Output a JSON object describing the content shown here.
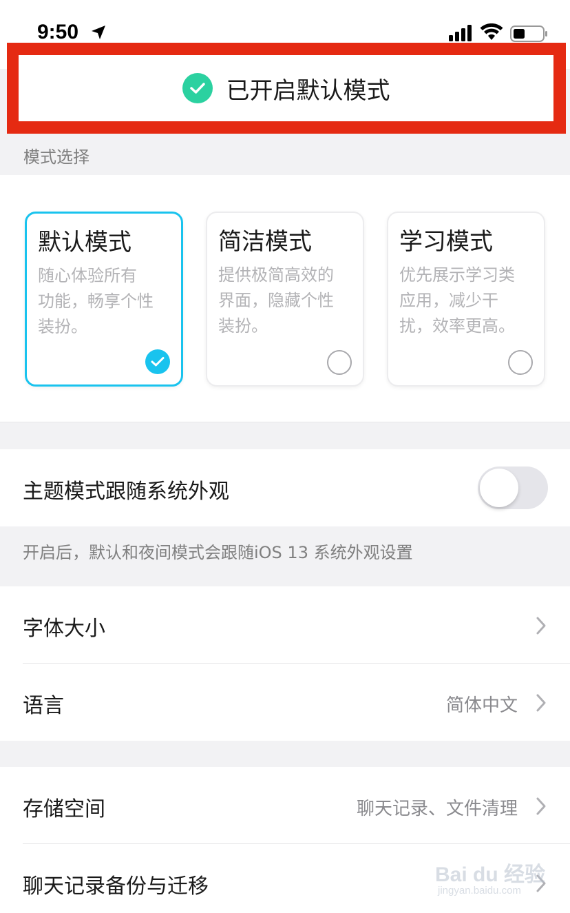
{
  "status_bar": {
    "time": "9:50"
  },
  "toast": {
    "text": "已开启默认模式"
  },
  "mode_section": {
    "header": "模式选择",
    "cards": [
      {
        "title": "默认模式",
        "desc_lines": [
          "随心体验所有",
          "功能，畅享个性",
          "装扮。"
        ],
        "selected": true
      },
      {
        "title": "简洁模式",
        "desc_lines": [
          "提供极简高效的",
          "界面，隐藏个性",
          "装扮。"
        ],
        "selected": false
      },
      {
        "title": "学习模式",
        "desc_lines": [
          "优先展示学习类",
          "应用，减少干",
          "扰，效率更高。"
        ],
        "selected": false
      }
    ]
  },
  "theme": {
    "label": "主题模式跟随系统外观",
    "toggle_on": false,
    "note": "开启后，默认和夜间模式会跟随iOS 13 系统外观设置"
  },
  "group1": {
    "font_size_label": "字体大小",
    "language_label": "语言",
    "language_value": "简体中文"
  },
  "group2": {
    "storage_label": "存储空间",
    "storage_value": "聊天记录、文件清理",
    "backup_label": "聊天记录备份与迁移"
  },
  "watermark": {
    "main": "Bai du 经验",
    "sub": "jingyan.baidu.com"
  },
  "colors": {
    "accent": "#19c3ee",
    "toast_check": "#2bd1a0",
    "highlight_outline": "#e52a12"
  }
}
